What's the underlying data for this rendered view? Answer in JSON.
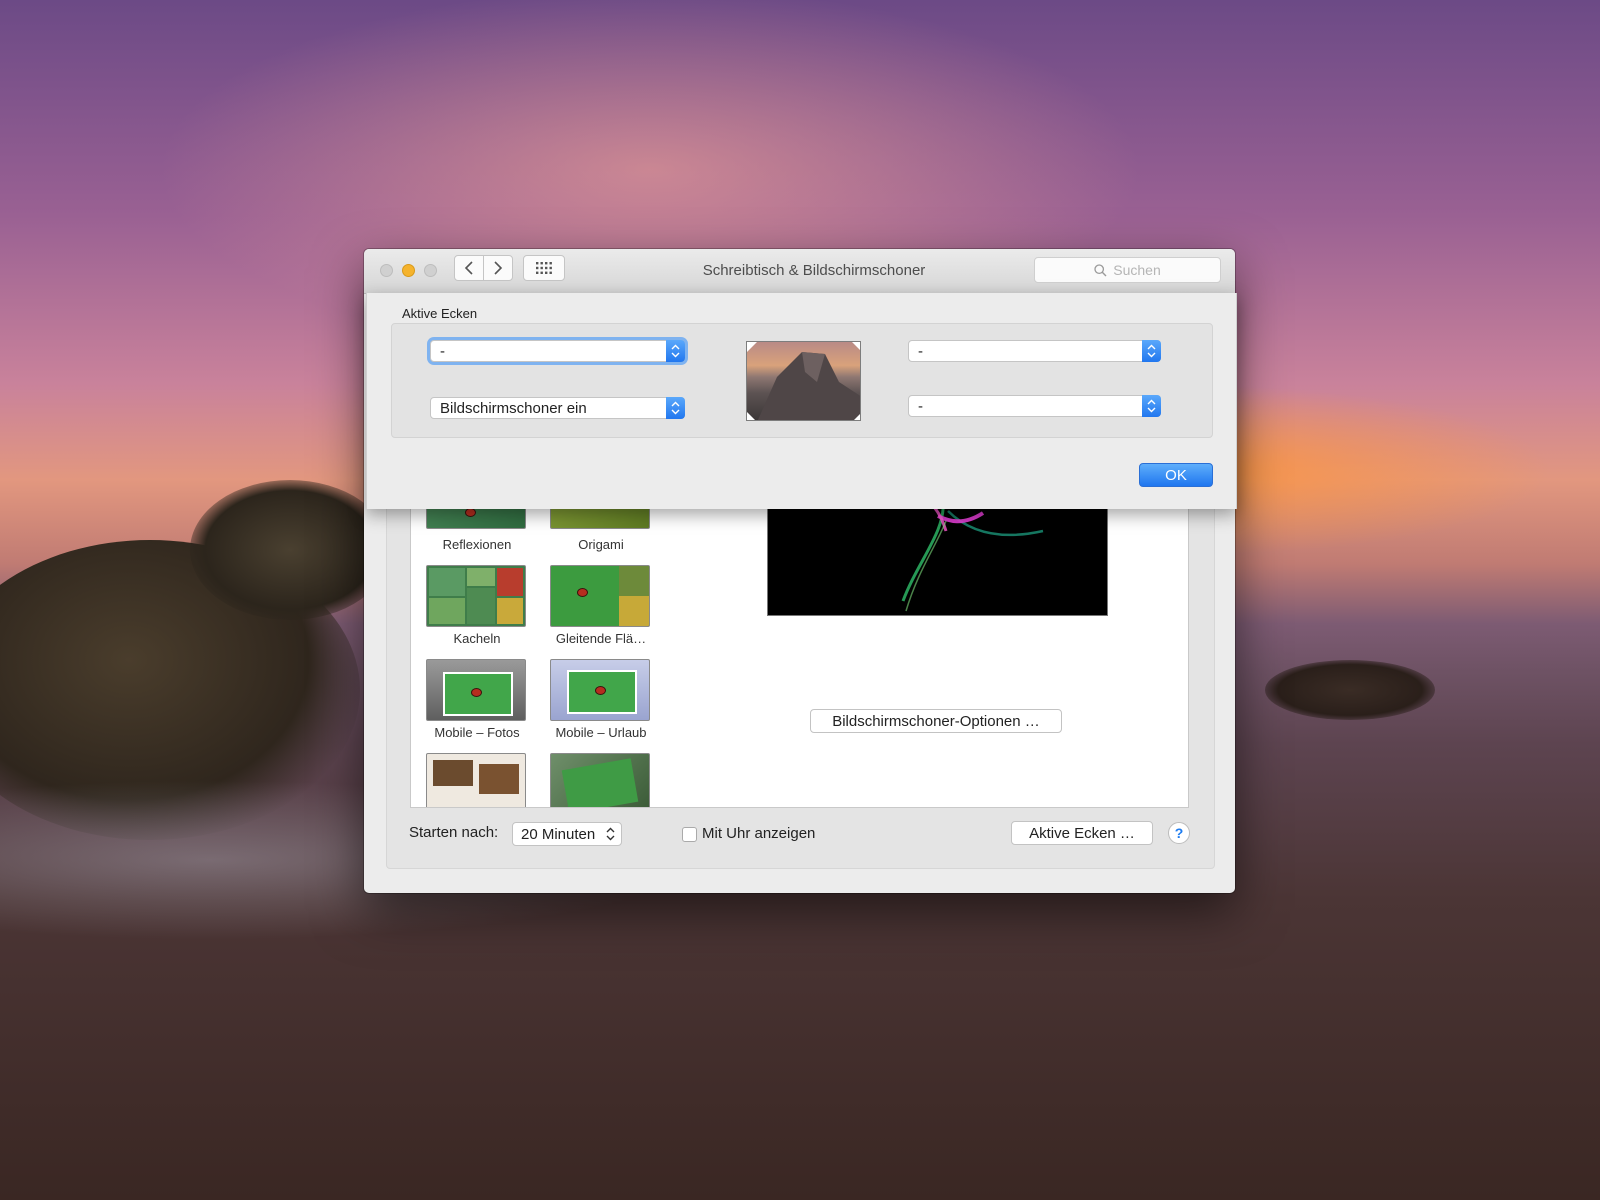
{
  "window": {
    "title": "Schreibtisch & Bildschirmschoner",
    "search_placeholder": "Suchen"
  },
  "screensavers": [
    {
      "label": "Reflexionen"
    },
    {
      "label": "Origami"
    },
    {
      "label": "Kacheln"
    },
    {
      "label": "Gleitende Flä…"
    },
    {
      "label": "Mobile – Fotos"
    },
    {
      "label": "Mobile – Urlaub"
    }
  ],
  "main": {
    "options_button": "Bildschirmschoner-Optionen …",
    "start_label": "Starten nach:",
    "start_value": "20 Minuten",
    "clock_label": "Mit Uhr anzeigen",
    "hot_corners_button": "Aktive Ecken …",
    "help": "?"
  },
  "sheet": {
    "title": "Aktive Ecken",
    "top_left": "-",
    "bottom_left": "Bildschirmschoner ein",
    "top_right": "-",
    "bottom_right": "-",
    "ok": "OK"
  },
  "colors": {
    "accent": "#1f76ef",
    "minimize": "#f5b32d"
  }
}
